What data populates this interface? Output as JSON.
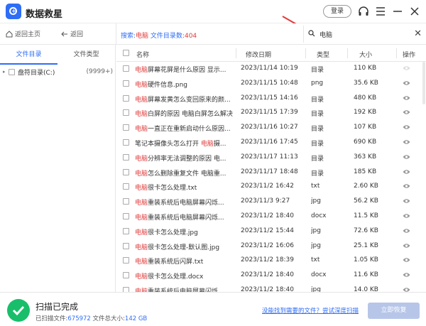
{
  "app": {
    "title": "数据救星",
    "login_label": "登录"
  },
  "nav": {
    "home_label": "返回主页",
    "back_label": "返回",
    "search_prefix": "搜索:",
    "search_term": "电脑",
    "search_suffix": " 文件目录数:",
    "search_count": "404"
  },
  "search": {
    "value": "电脑"
  },
  "sidebar": {
    "tabs": [
      {
        "label": "文件目录"
      },
      {
        "label": "文件类型"
      }
    ],
    "tree": [
      {
        "label": "盘符目录(C:)",
        "count": "(9999+)"
      }
    ]
  },
  "table": {
    "headers": {
      "name": "名称",
      "date": "修改日期",
      "type": "类型",
      "size": "大小",
      "op": "操作"
    },
    "rows": [
      {
        "pre": "",
        "hl": "电脑",
        "post": "屏幕花屏是什么原因 显示...",
        "date": "2023/11/14 10:19",
        "type": "目录",
        "size": "110 KB"
      },
      {
        "pre": "",
        "hl": "电脑",
        "post": "硬件信息.png",
        "date": "2023/11/15 10:48",
        "type": "png",
        "size": "35.6 KB"
      },
      {
        "pre": "",
        "hl": "电脑",
        "post": "屏幕发黄怎么变回原来的颜...",
        "date": "2023/11/15 14:16",
        "type": "目录",
        "size": "480 KB"
      },
      {
        "pre": "",
        "hl": "电脑",
        "post": "白屏的原因 电脑白屏怎么解决",
        "date": "2023/11/15 17:39",
        "type": "目录",
        "size": "192 KB"
      },
      {
        "pre": "",
        "hl": "电脑",
        "post": "一直正在重新启动什么原因...",
        "date": "2023/11/16 10:27",
        "type": "目录",
        "size": "107 KB"
      },
      {
        "pre": "笔记本摄像头怎么打开 ",
        "hl": "电脑",
        "post": "摄...",
        "date": "2023/11/16 17:45",
        "type": "目录",
        "size": "690 KB"
      },
      {
        "pre": "",
        "hl": "电脑",
        "post": "分辨率无法调整的原因 电...",
        "date": "2023/11/17 11:13",
        "type": "目录",
        "size": "363 KB"
      },
      {
        "pre": "",
        "hl": "电脑",
        "post": "怎么删除重复文件 电脑重...",
        "date": "2023/11/17 18:48",
        "type": "目录",
        "size": "185 KB"
      },
      {
        "pre": "",
        "hl": "电脑",
        "post": "很卡怎么处理.txt",
        "date": "2023/11/2 16:42",
        "type": "txt",
        "size": "2.60 KB"
      },
      {
        "pre": "",
        "hl": "电脑",
        "post": "重装系统后电脑屏幕闪烁...",
        "date": "2023/11/3 9:27",
        "type": "jpg",
        "size": "56.2 KB"
      },
      {
        "pre": "",
        "hl": "电脑",
        "post": "重装系统后电脑屏幕闪烁...",
        "date": "2023/11/2 18:40",
        "type": "docx",
        "size": "11.5 KB"
      },
      {
        "pre": "",
        "hl": "电脑",
        "post": "很卡怎么处理.jpg",
        "date": "2023/11/2 15:44",
        "type": "jpg",
        "size": "72.6 KB"
      },
      {
        "pre": "",
        "hl": "电脑",
        "post": "很卡怎么处理-默认图.jpg",
        "date": "2023/11/2 16:06",
        "type": "jpg",
        "size": "25.1 KB"
      },
      {
        "pre": "",
        "hl": "电脑",
        "post": "重装系统后闪屏.txt",
        "date": "2023/11/2 18:39",
        "type": "txt",
        "size": "1.05 KB"
      },
      {
        "pre": "",
        "hl": "电脑",
        "post": "很卡怎么处理.docx",
        "date": "2023/11/2 18:40",
        "type": "docx",
        "size": "11.6 KB"
      },
      {
        "pre": "",
        "hl": "电脑",
        "post": "重装系统后电脑屏幕闪烁...",
        "date": "2023/11/2 18:40",
        "type": "jpg",
        "size": "14.0 KB"
      }
    ]
  },
  "footer": {
    "status_title": "扫描已完成",
    "scanned_label": "已扫描文件:",
    "scanned_count": "675972",
    "total_label": "文件总大小:",
    "total_size": "142 GB",
    "deep_link": "没能找到需要的文件？尝试深度扫描",
    "recover_label": "立即恢复"
  },
  "colors": {
    "accent": "#2e6df6",
    "highlight": "#e03a3a",
    "success": "#19be6b",
    "disabled_button": "#b7c6e8"
  },
  "icons": [
    "app-logo-icon",
    "headset-icon",
    "menu-icon",
    "minimize-icon",
    "close-icon",
    "home-icon",
    "back-arrow-icon",
    "search-icon",
    "clear-icon",
    "preview-eye-icon",
    "check-circle-icon"
  ]
}
